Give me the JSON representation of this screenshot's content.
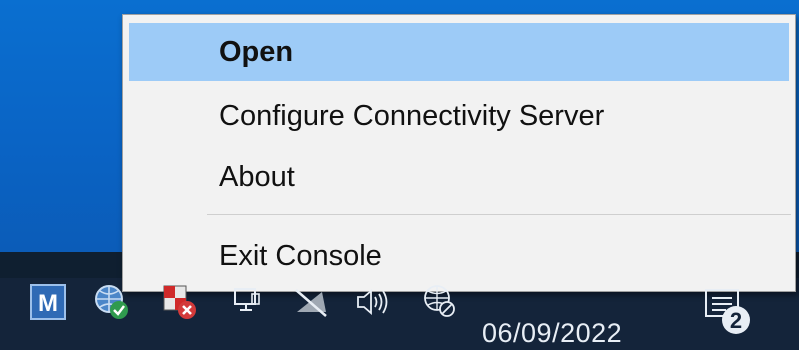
{
  "menu": {
    "items": [
      {
        "label": "Open",
        "highlighted": true
      },
      {
        "label": "Configure Connectivity Server",
        "highlighted": false
      },
      {
        "label": "About",
        "highlighted": false
      },
      {
        "label": "Exit Console",
        "highlighted": false
      }
    ]
  },
  "tray": {
    "icons": [
      {
        "name": "m-app-icon",
        "letter": "M"
      },
      {
        "name": "network-check-icon"
      },
      {
        "name": "security-alert-icon"
      },
      {
        "name": "monitor-icon"
      },
      {
        "name": "network-disabled-icon"
      },
      {
        "name": "volume-icon"
      },
      {
        "name": "globe-blocked-icon"
      }
    ],
    "clock_date": "06/09/2022",
    "notification_count": "2"
  },
  "colors": {
    "desktop": "#0a6fd0",
    "taskbar": "#14243a",
    "menu_bg": "#f2f2f2",
    "highlight": "#9dcbf7"
  }
}
